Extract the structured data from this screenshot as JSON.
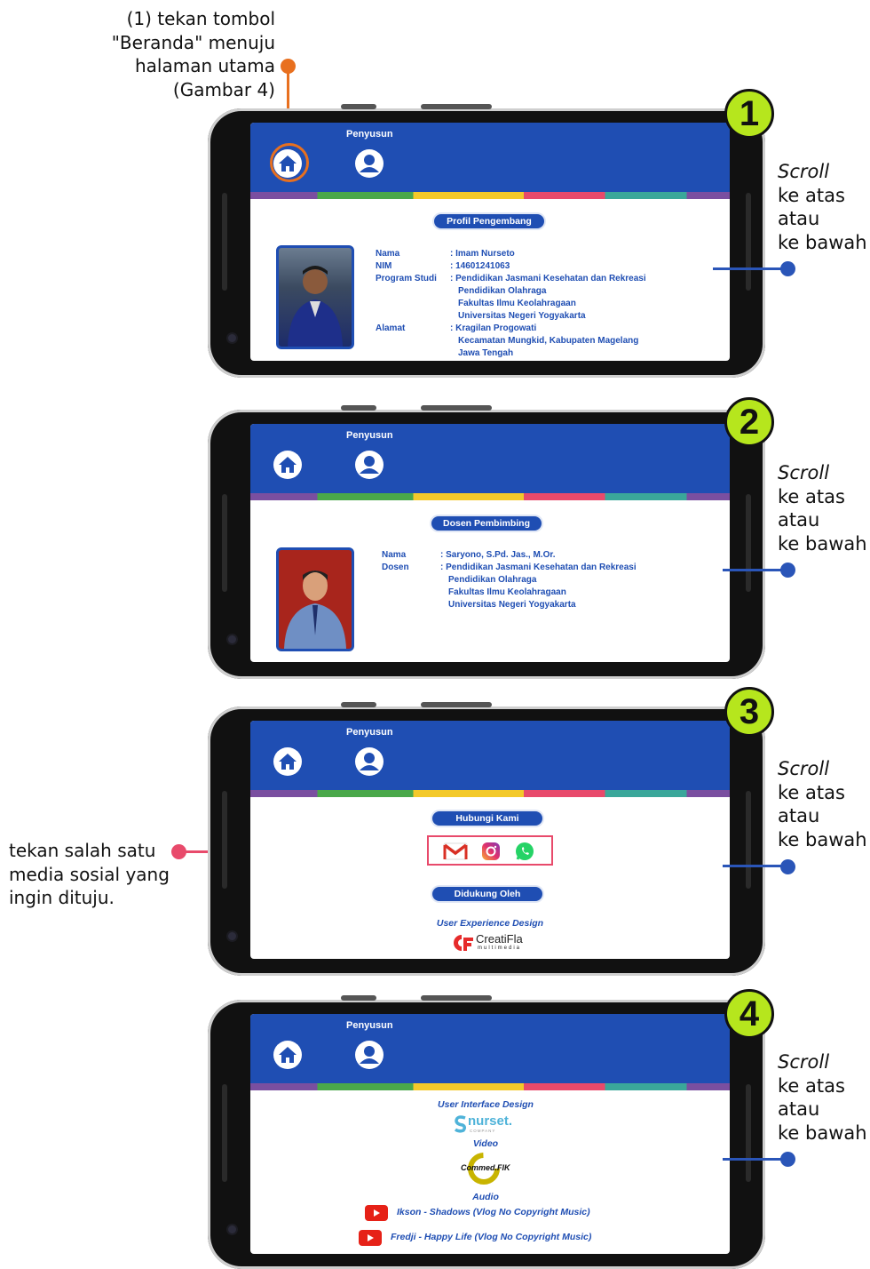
{
  "annotations": {
    "top_note": [
      "(1) tekan tombol",
      "\"Beranda\" menuju",
      "halaman utama",
      "(Gambar 4)"
    ],
    "left_note": [
      "tekan salah satu",
      "media sosial yang",
      "ingin dituju."
    ],
    "scroll_note": {
      "word": "Scroll",
      "lines": [
        "ke atas",
        "atau",
        "ke bawah"
      ]
    },
    "accent_orange": "#e8701f",
    "accent_pink": "#e84a6b",
    "accent_blue": "#2a55b8",
    "badge_color": "#b6e61d"
  },
  "header": {
    "title": "Penyusun",
    "home_icon": "home-icon",
    "user_icon": "user-icon",
    "bar_color": "#1f4eb3",
    "stripe_colors": [
      "#7a4fa0",
      "#4aa84a",
      "#f3c92a",
      "#e84a6b",
      "#3aa79a",
      "#7a4fa0"
    ]
  },
  "screens": [
    {
      "badge": "1",
      "pill": "Profil Pengembang",
      "profile": {
        "labels": [
          "Nama",
          "NIM",
          "Program Studi",
          "",
          "",
          "",
          "Alamat",
          "",
          ""
        ],
        "values": [
          ": Imam Nurseto",
          ": 14601241063",
          ": Pendidikan Jasmani Kesehatan dan Rekreasi",
          "Pendidikan Olahraga",
          "Fakultas Ilmu Keolahragaan",
          "Universitas Negeri Yogyakarta",
          ": Kragilan Progowati",
          "Kecamatan Mungkid, Kabupaten Magelang",
          "Jawa Tengah"
        ]
      }
    },
    {
      "badge": "2",
      "pill": "Dosen Pembimbing",
      "profile": {
        "labels": [
          "Nama",
          "Dosen",
          "",
          "",
          ""
        ],
        "values": [
          ": Saryono, S.Pd. Jas., M.Or.",
          ": Pendidikan Jasmani Kesehatan dan Rekreasi",
          "Pendidikan Olahraga",
          "Fakultas Ilmu Keolahragaan",
          "Universitas Negeri Yogyakarta"
        ]
      }
    },
    {
      "badge": "3",
      "pill": "Hubungi Kami",
      "social_icons": [
        "gmail-icon",
        "instagram-icon",
        "whatsapp-icon"
      ],
      "pill2": "Didukung Oleh",
      "ux_label": "User Experience Design",
      "logo_main": "CreatiFla",
      "logo_sub": "multimedia"
    },
    {
      "badge": "4",
      "ui_label": "User Interface Design",
      "nurset_logo": "nurset.",
      "nurset_sub": "COMPANY",
      "video_label": "Video",
      "commed_logo": "Commed.FIK",
      "audio_label": "Audio",
      "tracks": [
        "Ikson - Shadows (Vlog No Copyright Music)",
        "Fredji - Happy Life (Vlog No Copyright Music)"
      ]
    }
  ]
}
